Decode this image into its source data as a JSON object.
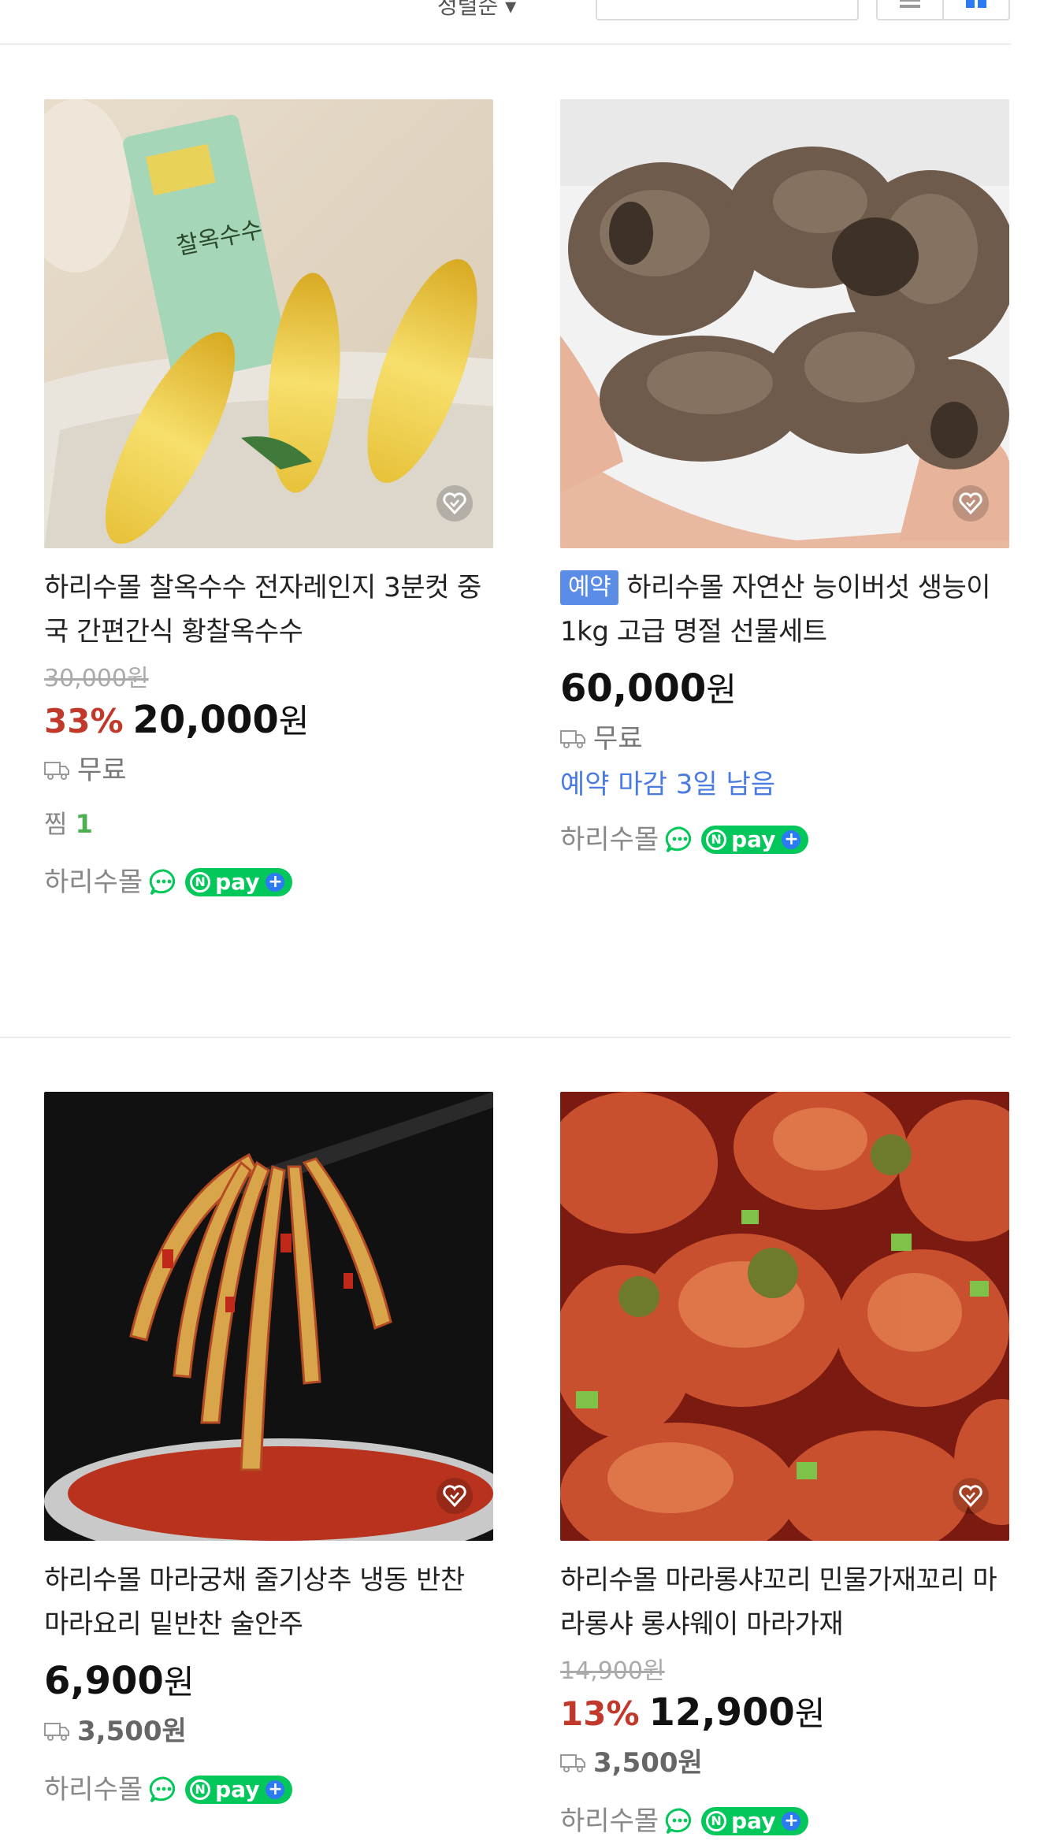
{
  "toolbar": {
    "sort_label": "정렬순 ▾"
  },
  "products": [
    {
      "title": "하리수몰 찰옥수수 전자레인지 3분컷 중국 간편간식 황찰옥수수",
      "original_price": "30,000원",
      "discount": "33%",
      "price": "20,000",
      "won": "원",
      "shipping": "무료",
      "zzim_label": "찜",
      "zzim_count": "1",
      "seller": "하리수몰",
      "npay": "pay"
    },
    {
      "badge": "예약",
      "title": "하리수몰 자연산 능이버섯 생능이 1kg 고급 명절 선물세트",
      "price": "60,000",
      "won": "원",
      "shipping": "무료",
      "deadline": "예약 마감 3일 남음",
      "seller": "하리수몰",
      "npay": "pay"
    },
    {
      "title": "하리수몰 마라궁채 줄기상추 냉동 반찬 마라요리 밑반찬 술안주",
      "price": "6,900",
      "won": "원",
      "shipping": "3,500원",
      "seller": "하리수몰",
      "npay": "pay"
    },
    {
      "title": "하리수몰 마라롱샤꼬리 민물가재꼬리 마라롱샤 롱샤웨이 마라가재",
      "original_price": "14,900원",
      "discount": "13%",
      "price": "12,900",
      "won": "원",
      "shipping": "3,500원",
      "seller": "하리수몰",
      "npay": "pay"
    }
  ],
  "image_labels": {
    "corn_pack_brand": "찰옥수수"
  }
}
